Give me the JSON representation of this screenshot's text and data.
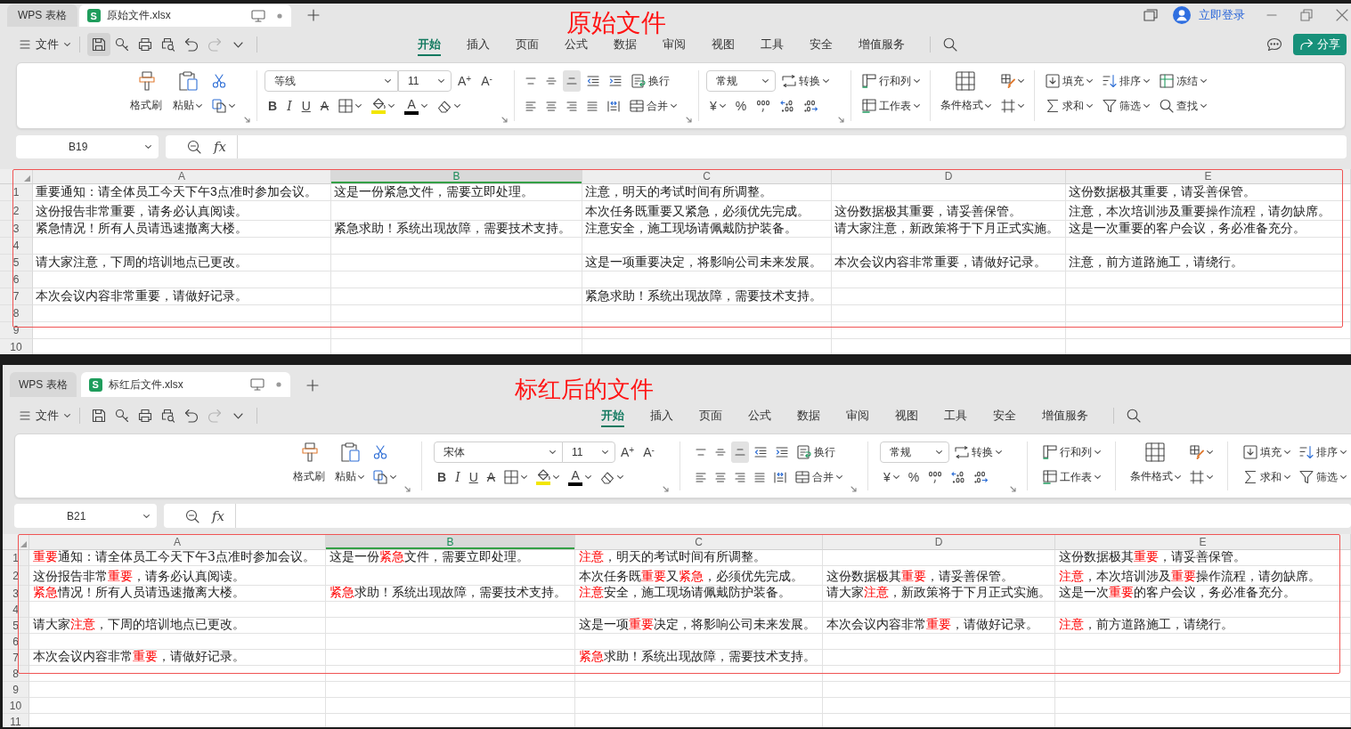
{
  "windows": [
    {
      "kind": "full",
      "caption": "原始文件",
      "outlined": true,
      "tabs": [
        {
          "label": "WPS 表格",
          "selected": false
        },
        {
          "badge": "S",
          "label": "原始文件.xlsx",
          "selected": true
        }
      ],
      "account": {
        "login": "立即登录"
      },
      "menu": {
        "file": "文件",
        "quick_tools": [
          {
            "active": true,
            "disabled": false
          },
          {
            "active": false,
            "disabled": false
          },
          {
            "active": false,
            "disabled": false
          },
          {
            "active": false,
            "disabled": false
          },
          {
            "active": false,
            "disabled": false
          },
          {
            "active": false,
            "disabled": true
          }
        ],
        "tabs": [
          {
            "label": "开始",
            "selected": true
          },
          {
            "label": "插入",
            "selected": false
          },
          {
            "label": "页面",
            "selected": false
          },
          {
            "label": "公式",
            "selected": false
          },
          {
            "label": "数据",
            "selected": false
          },
          {
            "label": "审阅",
            "selected": false
          },
          {
            "label": "视图",
            "selected": false
          },
          {
            "label": "工具",
            "selected": false
          },
          {
            "label": "安全",
            "selected": false
          },
          {
            "label": "增值服务",
            "selected": false
          }
        ],
        "share": "分享"
      },
      "ribbon": [
        {
          "launcher": true,
          "parts": [
            {
              "kind": "large",
              "label": "格式刷"
            },
            {
              "kind": "large",
              "label": "粘贴",
              "dropdown": true
            },
            {
              "kind": "stack",
              "upper": [
                {
                  "kind": "icon"
                }
              ],
              "lower": [
                {
                  "kind": "icon",
                  "dropdown": true
                }
              ]
            }
          ]
        },
        {
          "launcher": true,
          "parts": [
            {
              "kind": "stack",
              "upper": [
                {
                  "kind": "combo",
                  "value": "等线"
                },
                {
                  "kind": "combo",
                  "value": "11"
                },
                {
                  "kind": "glyph",
                  "text": "A$^{+}$"
                },
                {
                  "kind": "glyph",
                  "text": "A$^{-}$"
                }
              ],
              "lower": [
                {
                  "kind": "glyph",
                  "text": "B"
                },
                {
                  "kind": "glyph",
                  "text": "I"
                },
                {
                  "kind": "glyph",
                  "text": "U"
                },
                {
                  "kind": "glyph",
                  "text": "A"
                },
                {
                  "kind": "icon",
                  "dropdown": true
                },
                {
                  "kind": "icon",
                  "dropdown": true,
                  "color": "#f2e600"
                },
                {
                  "kind": "glyph",
                  "text": "A",
                  "dropdown": true,
                  "color": "#000000"
                },
                {
                  "kind": "icon",
                  "dropdown": true
                }
              ]
            }
          ]
        },
        {
          "launcher": true,
          "parts": [
            {
              "kind": "stack",
              "upper": [
                {
                  "kind": "icon",
                  "selected": false
                },
                {
                  "kind": "icon",
                  "selected": false
                },
                {
                  "kind": "icon",
                  "selected": true
                },
                {
                  "kind": "icon"
                },
                {
                  "kind": "icon"
                },
                {
                  "kind": "icon",
                  "label": "换行"
                }
              ],
              "lower": [
                {
                  "kind": "icon",
                  "selected": false
                },
                {
                  "kind": "icon",
                  "selected": false
                },
                {
                  "kind": "icon",
                  "selected": false
                },
                {
                  "kind": "icon",
                  "selected": false
                },
                {
                  "kind": "icon",
                  "selected": false
                },
                {
                  "kind": "icon",
                  "label": "合并",
                  "dropdown": true
                }
              ]
            }
          ]
        },
        {
          "launcher": true,
          "parts": [
            {
              "kind": "stack",
              "upper": [
                {
                  "kind": "combo",
                  "value": "常规"
                },
                {
                  "kind": "icon",
                  "label": "转换",
                  "dropdown": true
                }
              ],
              "lower": [
                {
                  "kind": "glyph",
                  "text": "¥",
                  "dropdown": true
                },
                {
                  "kind": "glyph",
                  "text": "%"
                },
                {
                  "kind": "icon"
                },
                {
                  "kind": "icon"
                },
                {
                  "kind": "icon"
                }
              ]
            }
          ]
        },
        {
          "parts": [
            {
              "kind": "stack",
              "upper": [
                {
                  "kind": "icon",
                  "label": "行和列",
                  "dropdown": true
                }
              ],
              "lower": [
                {
                  "kind": "icon",
                  "label": "工作表",
                  "dropdown": true
                }
              ]
            }
          ]
        },
        {
          "parts": [
            {
              "kind": "large",
              "label": "条件格式",
              "dropdown": true
            },
            {
              "kind": "stack",
              "upper": [
                {
                  "kind": "icon",
                  "dropdown": true
                }
              ],
              "lower": [
                {
                  "kind": "icon",
                  "dropdown": true
                }
              ]
            }
          ]
        },
        {
          "parts": [
            {
              "kind": "stack",
              "upper": [
                {
                  "kind": "icon",
                  "label": "填充",
                  "dropdown": true
                },
                {
                  "kind": "icon",
                  "label": "排序",
                  "dropdown": true
                },
                {
                  "kind": "icon",
                  "label": "冻结",
                  "dropdown": true
                }
              ],
              "lower": [
                {
                  "kind": "icon",
                  "label": "求和",
                  "dropdown": true
                },
                {
                  "kind": "icon",
                  "label": "筛选",
                  "dropdown": true
                },
                {
                  "kind": "icon",
                  "label": "查找",
                  "dropdown": true
                }
              ]
            }
          ]
        }
      ],
      "formula_bar": {
        "cell": "B19",
        "function": "fx"
      },
      "sheet": {
        "columns": [
          {
            "label": "A",
            "selected": false
          },
          {
            "label": "B",
            "selected": true
          },
          {
            "label": "C",
            "selected": false
          },
          {
            "label": "D",
            "selected": false
          },
          {
            "label": "E",
            "selected": false
          }
        ],
        "rows": [
          {
            "label": "1",
            "cells": [
              "重要通知：请全体员工今天下午3点准时参加会议。",
              "这是一份紧急文件，需要立即处理。",
              "注意，明天的考试时间有所调整。",
              null,
              "这份数据极其重要，请妥善保管。"
            ]
          },
          {
            "label": "2",
            "cells": [
              "这份报告非常重要，请务必认真阅读。",
              null,
              "本次任务既重要又紧急，必须优先完成。",
              "这份数据极其重要，请妥善保管。",
              "注意，本次培训涉及重要操作流程，请勿缺席。"
            ]
          },
          {
            "label": "3",
            "cells": [
              "紧急情况！所有人员请迅速撤离大楼。",
              "紧急求助！系统出现故障，需要技术支持。",
              "注意安全，施工现场请佩戴防护装备。",
              "请大家注意，新政策将于下月正式实施。",
              "这是一次重要的客户会议，务必准备充分。"
            ]
          },
          {
            "label": "4"
          },
          {
            "label": "5",
            "cells": [
              "请大家注意，下周的培训地点已更改。",
              null,
              "这是一项重要决定，将影响公司未来发展。",
              "本次会议内容非常重要，请做好记录。",
              "注意，前方道路施工，请绕行。"
            ]
          },
          {
            "label": "6"
          },
          {
            "label": "7",
            "cells": [
              "本次会议内容非常重要，请做好记录。",
              null,
              "紧急求助！系统出现故障，需要技术支持。"
            ]
          },
          {
            "label": "8"
          },
          {
            "label": "9"
          },
          {
            "label": "10"
          }
        ]
      }
    },
    {
      "kind": "cropped",
      "caption": "标红后的文件",
      "outlined": true,
      "tabs": [
        {
          "label": "WPS 表格",
          "selected": false
        },
        {
          "badge": "S",
          "label": "标红后文件.xlsx",
          "selected": true
        }
      ],
      "menu": {
        "file": "文件",
        "quick_tools": [
          {
            "active": false,
            "disabled": false
          },
          {
            "active": false,
            "disabled": false
          },
          {
            "active": false,
            "disabled": false
          },
          {
            "active": false,
            "disabled": false
          },
          {
            "active": false,
            "disabled": false
          },
          {
            "active": false,
            "disabled": true
          }
        ],
        "tabs": [
          {
            "label": "开始",
            "selected": true
          },
          {
            "label": "插入",
            "selected": false
          },
          {
            "label": "页面",
            "selected": false
          },
          {
            "label": "公式",
            "selected": false
          },
          {
            "label": "数据",
            "selected": false
          },
          {
            "label": "审阅",
            "selected": false
          },
          {
            "label": "视图",
            "selected": false
          },
          {
            "label": "工具",
            "selected": false
          },
          {
            "label": "安全",
            "selected": false
          },
          {
            "label": "增值服务",
            "selected": false
          }
        ]
      },
      "ribbon": [
        {
          "launcher": true,
          "parts": [
            {
              "kind": "large",
              "label": "格式刷"
            },
            {
              "kind": "large",
              "label": "粘贴",
              "dropdown": true
            },
            {
              "kind": "stack",
              "upper": [
                {
                  "kind": "icon"
                }
              ],
              "lower": [
                {
                  "kind": "icon",
                  "dropdown": true
                }
              ]
            }
          ]
        },
        {
          "launcher": true,
          "parts": [
            {
              "kind": "stack",
              "upper": [
                {
                  "kind": "combo",
                  "value": "宋体"
                },
                {
                  "kind": "combo",
                  "value": "11"
                },
                {
                  "kind": "glyph",
                  "text": "A$^{+}$"
                },
                {
                  "kind": "glyph",
                  "text": "A$^{-}$"
                }
              ],
              "lower": [
                {
                  "kind": "glyph",
                  "text": "B"
                },
                {
                  "kind": "glyph",
                  "text": "I"
                },
                {
                  "kind": "glyph",
                  "text": "U"
                },
                {
                  "kind": "glyph",
                  "text": "A"
                },
                {
                  "kind": "icon",
                  "dropdown": true
                },
                {
                  "kind": "icon",
                  "dropdown": true,
                  "color": "#f2e600"
                },
                {
                  "kind": "glyph",
                  "text": "A",
                  "dropdown": true,
                  "color": "#000000"
                },
                {
                  "kind": "icon",
                  "dropdown": true
                }
              ]
            }
          ]
        },
        {
          "launcher": true,
          "parts": [
            {
              "kind": "stack",
              "upper": [
                {
                  "kind": "icon",
                  "selected": false
                },
                {
                  "kind": "icon",
                  "selected": false
                },
                {
                  "kind": "icon",
                  "selected": true
                },
                {
                  "kind": "icon"
                },
                {
                  "kind": "icon"
                },
                {
                  "kind": "icon",
                  "label": "换行"
                }
              ],
              "lower": [
                {
                  "kind": "icon",
                  "selected": false
                },
                {
                  "kind": "icon",
                  "selected": false
                },
                {
                  "kind": "icon",
                  "selected": false
                },
                {
                  "kind": "icon",
                  "selected": false
                },
                {
                  "kind": "icon",
                  "selected": false
                },
                {
                  "kind": "icon",
                  "label": "合并",
                  "dropdown": true
                }
              ]
            }
          ]
        },
        {
          "launcher": true,
          "parts": [
            {
              "kind": "stack",
              "upper": [
                {
                  "kind": "combo",
                  "value": "常规"
                },
                {
                  "kind": "icon",
                  "label": "转换",
                  "dropdown": true
                }
              ],
              "lower": [
                {
                  "kind": "glyph",
                  "text": "¥",
                  "dropdown": true
                },
                {
                  "kind": "glyph",
                  "text": "%"
                },
                {
                  "kind": "icon"
                },
                {
                  "kind": "icon"
                },
                {
                  "kind": "icon"
                }
              ]
            }
          ]
        },
        {
          "parts": [
            {
              "kind": "stack",
              "upper": [
                {
                  "kind": "icon",
                  "label": "行和列",
                  "dropdown": true
                }
              ],
              "lower": [
                {
                  "kind": "icon",
                  "label": "工作表",
                  "dropdown": true
                }
              ]
            }
          ]
        },
        {
          "parts": [
            {
              "kind": "large",
              "label": "条件格式",
              "dropdown": true
            },
            {
              "kind": "stack",
              "upper": [
                {
                  "kind": "icon",
                  "dropdown": true
                }
              ],
              "lower": [
                {
                  "kind": "icon",
                  "dropdown": true
                }
              ]
            }
          ]
        },
        {
          "parts": [
            {
              "kind": "stack",
              "upper": [
                {
                  "kind": "icon",
                  "label": "填充",
                  "dropdown": true
                },
                {
                  "kind": "icon",
                  "label": "排序",
                  "dropdown": true
                }
              ],
              "lower": [
                {
                  "kind": "icon",
                  "label": "求和",
                  "dropdown": true
                },
                {
                  "kind": "icon",
                  "label": "筛选",
                  "dropdown": true
                }
              ]
            }
          ]
        }
      ],
      "formula_bar": {
        "cell": "B21",
        "function": "fx"
      },
      "sheet": {
        "columns": [
          {
            "label": "A",
            "selected": false
          },
          {
            "label": "B",
            "selected": true
          },
          {
            "label": "C",
            "selected": false
          },
          {
            "label": "D",
            "selected": false
          },
          {
            "label": "E",
            "selected": false
          }
        ],
        "rows": [
          {
            "label": "1",
            "cells": [
              [
                {
                  "text": "重要",
                  "highlighted": true
                },
                {
                  "text": "通知：请全体员工今天下午3点准时参加会议。",
                  "highlighted": false
                }
              ],
              [
                {
                  "text": "这是一份",
                  "highlighted": false
                },
                {
                  "text": "紧急",
                  "highlighted": true
                },
                {
                  "text": "文件，需要立即处理。",
                  "highlighted": false
                }
              ],
              [
                {
                  "text": "注意",
                  "highlighted": true
                },
                {
                  "text": "，明天的考试时间有所调整。",
                  "highlighted": false
                }
              ],
              null,
              [
                {
                  "text": "这份数据极其",
                  "highlighted": false
                },
                {
                  "text": "重要",
                  "highlighted": true
                },
                {
                  "text": "，请妥善保管。",
                  "highlighted": false
                }
              ]
            ]
          },
          {
            "label": "2",
            "cells": [
              [
                {
                  "text": "这份报告非常",
                  "highlighted": false
                },
                {
                  "text": "重要",
                  "highlighted": true
                },
                {
                  "text": "，请务必认真阅读。",
                  "highlighted": false
                }
              ],
              null,
              [
                {
                  "text": "本次任务既",
                  "highlighted": false
                },
                {
                  "text": "重要",
                  "highlighted": true
                },
                {
                  "text": "又",
                  "highlighted": false
                },
                {
                  "text": "紧急",
                  "highlighted": true
                },
                {
                  "text": "，必须优先完成。",
                  "highlighted": false
                }
              ],
              [
                {
                  "text": "这份数据极其",
                  "highlighted": false
                },
                {
                  "text": "重要",
                  "highlighted": true
                },
                {
                  "text": "，请妥善保管。",
                  "highlighted": false
                }
              ],
              [
                {
                  "text": "注意",
                  "highlighted": true
                },
                {
                  "text": "，本次培训涉及",
                  "highlighted": false
                },
                {
                  "text": "重要",
                  "highlighted": true
                },
                {
                  "text": "操作流程，请勿缺席。",
                  "highlighted": false
                }
              ]
            ]
          },
          {
            "label": "3",
            "cells": [
              [
                {
                  "text": "紧急",
                  "highlighted": true
                },
                {
                  "text": "情况！所有人员请迅速撤离大楼。",
                  "highlighted": false
                }
              ],
              [
                {
                  "text": "紧急",
                  "highlighted": true
                },
                {
                  "text": "求助！系统出现故障，需要技术支持。",
                  "highlighted": false
                }
              ],
              [
                {
                  "text": "注意",
                  "highlighted": true
                },
                {
                  "text": "安全，施工现场请佩戴防护装备。",
                  "highlighted": false
                }
              ],
              [
                {
                  "text": "请大家",
                  "highlighted": false
                },
                {
                  "text": "注意",
                  "highlighted": true
                },
                {
                  "text": "，新政策将于下月正式实施。",
                  "highlighted": false
                }
              ],
              [
                {
                  "text": "这是一次",
                  "highlighted": false
                },
                {
                  "text": "重要",
                  "highlighted": true
                },
                {
                  "text": "的客户会议，务必准备充分。",
                  "highlighted": false
                }
              ]
            ]
          },
          {
            "label": "4"
          },
          {
            "label": "5",
            "cells": [
              [
                {
                  "text": "请大家",
                  "highlighted": false
                },
                {
                  "text": "注意",
                  "highlighted": true
                },
                {
                  "text": "，下周的培训地点已更改。",
                  "highlighted": false
                }
              ],
              null,
              [
                {
                  "text": "这是一项",
                  "highlighted": false
                },
                {
                  "text": "重要",
                  "highlighted": true
                },
                {
                  "text": "决定，将影响公司未来发展。",
                  "highlighted": false
                }
              ],
              [
                {
                  "text": "本次会议内容非常",
                  "highlighted": false
                },
                {
                  "text": "重要",
                  "highlighted": true
                },
                {
                  "text": "，请做好记录。",
                  "highlighted": false
                }
              ],
              [
                {
                  "text": "注意",
                  "highlighted": true
                },
                {
                  "text": "，前方道路施工，请绕行。",
                  "highlighted": false
                }
              ]
            ]
          },
          {
            "label": "6"
          },
          {
            "label": "7",
            "cells": [
              [
                {
                  "text": "本次会议内容非常",
                  "highlighted": false
                },
                {
                  "text": "重要",
                  "highlighted": true
                },
                {
                  "text": "，请做好记录。",
                  "highlighted": false
                }
              ],
              null,
              [
                {
                  "text": "紧急",
                  "highlighted": true
                },
                {
                  "text": "求助！系统出现故障，需要技术支持。",
                  "highlighted": false
                }
              ]
            ]
          },
          {
            "label": "8"
          },
          {
            "label": "9"
          },
          {
            "label": "10"
          },
          {
            "label": "11"
          }
        ]
      }
    }
  ]
}
